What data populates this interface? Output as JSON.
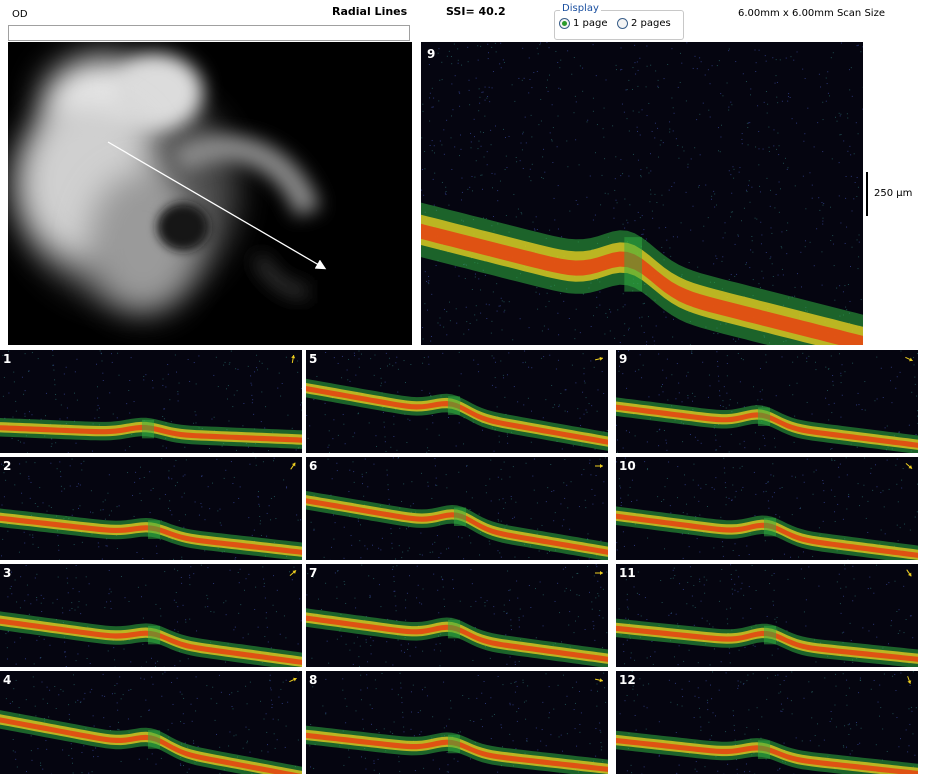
{
  "header": {
    "eye": "OD",
    "scan_type": "Radial Lines",
    "ssi": "SSI= 40.2",
    "scan_size": "6.00mm x 6.00mm Scan Size"
  },
  "display": {
    "legend": "Display",
    "option_1": "1 page",
    "option_2": "2 pages",
    "selected": "1 page"
  },
  "main_bscan": {
    "number": "9"
  },
  "scale": {
    "label": "250 µm"
  },
  "thumbnails": [
    {
      "number": "1"
    },
    {
      "number": "2"
    },
    {
      "number": "3"
    },
    {
      "number": "4"
    },
    {
      "number": "5"
    },
    {
      "number": "6"
    },
    {
      "number": "7"
    },
    {
      "number": "8"
    },
    {
      "number": "9"
    },
    {
      "number": "10"
    },
    {
      "number": "11"
    },
    {
      "number": "12"
    }
  ],
  "colors": {
    "scan_background": "#050510",
    "retina_high": "#e83a10",
    "retina_mid": "#f0d020",
    "retina_low": "#30b040",
    "arrow": "#f0d020"
  }
}
